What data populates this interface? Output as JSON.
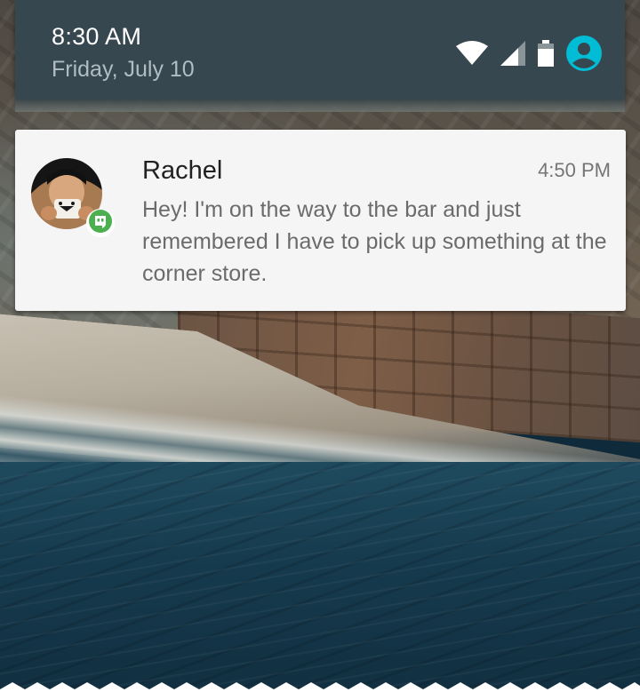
{
  "status_bar": {
    "time": "8:30 AM",
    "date": "Friday, July 10",
    "icons": [
      "wifi-icon",
      "cell-signal-icon",
      "battery-icon",
      "user-account-icon"
    ],
    "accent_color": "#00bcd4"
  },
  "notification": {
    "sender": "Rachel",
    "time": "4:50 PM",
    "message": "Hey! I'm on the way to the bar and just remembered I have to pick up something at the corner store.",
    "app_icon": "hangouts-icon",
    "app_color": "#4caf50"
  },
  "colors": {
    "header_bg": "#37474f",
    "card_bg": "#f5f5f5"
  }
}
